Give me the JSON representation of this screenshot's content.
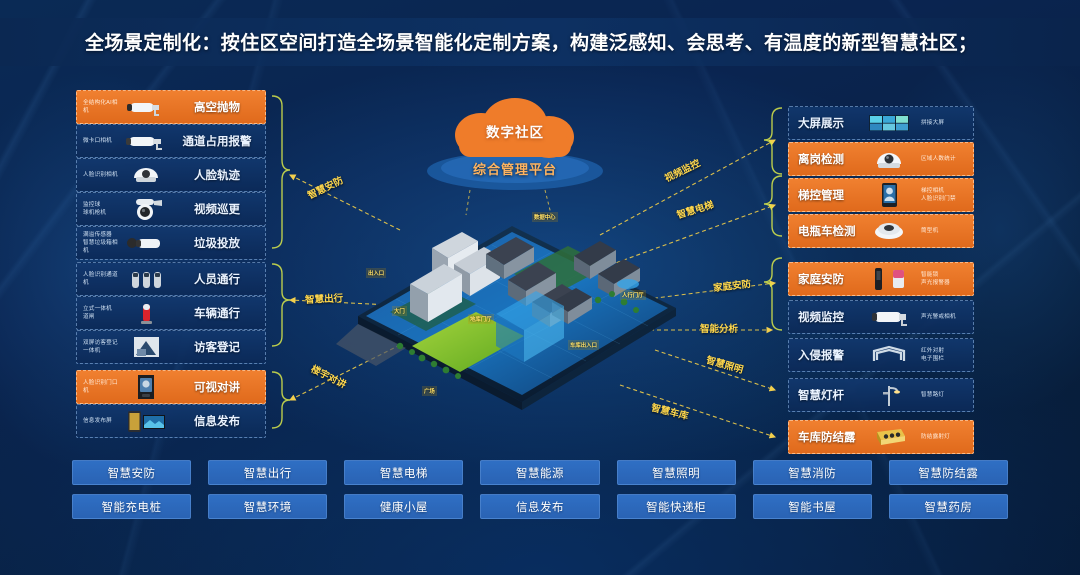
{
  "header": {
    "title": "全场景定制化：按住区空间打造全场景智能化定制方案，构建泛感知、会思考、有温度的新型智慧社区；"
  },
  "center": {
    "cloud_label": "数字社区",
    "platform_label": "综合管理平台",
    "city_labels": [
      "数据中心",
      "人行门厅",
      "地库门厅",
      "车库出入口",
      "出入口",
      "大门",
      "广场"
    ]
  },
  "connectors": {
    "left": [
      {
        "label": "智慧安防"
      },
      {
        "label": "智慧出行"
      },
      {
        "label": "楼宇对讲"
      }
    ],
    "right": [
      {
        "label": "视频监控"
      },
      {
        "label": "智慧电梯"
      },
      {
        "label": "家庭安防"
      },
      {
        "label": "智能分析"
      },
      {
        "label": "智慧照明"
      },
      {
        "label": "智慧车库"
      }
    ]
  },
  "left_groups": [
    {
      "name": "security-group",
      "items": [
        {
          "tiny": "全结构化AI相机",
          "title": "高空抛物",
          "icon": "bullet-camera-icon",
          "highlight": true
        },
        {
          "tiny": "微卡口相机",
          "title": "通道占用报警",
          "icon": "bullet-camera-icon",
          "highlight": false
        },
        {
          "tiny": "人脸识别相机",
          "title": "人脸轨迹",
          "icon": "dome-camera-icon",
          "highlight": false
        },
        {
          "tiny": "监控球\n球机枪机",
          "title": "视频巡更",
          "icon": "ptz-camera-icon",
          "highlight": false
        },
        {
          "tiny": "满溢传感器\n智慧垃圾箱相机",
          "title": "垃圾投放",
          "icon": "bullet-camera-icon",
          "highlight": false
        }
      ]
    },
    {
      "name": "access-group",
      "items": [
        {
          "tiny": "人脸识别通道机",
          "title": "人员通行",
          "icon": "turnstile-icon",
          "highlight": false
        },
        {
          "tiny": "立式一体机\n道闸",
          "title": "车辆通行",
          "icon": "barrier-gate-icon",
          "highlight": false
        },
        {
          "tiny": "双屏访客登记一体机",
          "title": "访客登记",
          "icon": "visitor-kiosk-icon",
          "highlight": false
        }
      ]
    },
    {
      "name": "intercom-group",
      "items": [
        {
          "tiny": "人脸识别门口机",
          "title": "可视对讲",
          "icon": "door-station-icon",
          "highlight": true
        },
        {
          "tiny": "信息发布屏",
          "title": "信息发布",
          "icon": "display-screen-icon",
          "highlight": false
        }
      ]
    }
  ],
  "right_groups": [
    {
      "name": "monitoring-group",
      "items": [
        {
          "title": "大屏展示",
          "tiny": "拼接大屏",
          "icon": "video-wall-icon",
          "highlight": false
        },
        {
          "title": "离岗检测",
          "tiny": "区域人数统计",
          "icon": "dome-camera-icon",
          "highlight": true
        }
      ]
    },
    {
      "name": "elevator-group",
      "items": [
        {
          "title": "梯控管理",
          "tiny": "梯控相机\n人脸识别门禁",
          "icon": "face-terminal-icon",
          "highlight": true
        },
        {
          "title": "电瓶车检测",
          "tiny": "筒型机",
          "icon": "fisheye-camera-icon",
          "highlight": true
        }
      ]
    },
    {
      "name": "home-group",
      "items": [
        {
          "title": "家庭安防",
          "tiny": "智能锁\n声光报警器",
          "icon": "smart-lock-icon",
          "highlight": true
        },
        {
          "title": "视频监控",
          "tiny": "声光警戒相机",
          "icon": "bullet-camera-icon",
          "highlight": false
        },
        {
          "title": "入侵报警",
          "tiny": "红外对射\n电子围栏",
          "icon": "perimeter-fence-icon",
          "highlight": false
        }
      ]
    },
    {
      "name": "lighting-group",
      "items": [
        {
          "title": "智慧灯杆",
          "tiny": "智慧路灯",
          "icon": "smart-pole-icon",
          "highlight": false
        }
      ]
    },
    {
      "name": "garage-group",
      "items": [
        {
          "title": "车库防结露",
          "tiny": "防结露射灯",
          "icon": "spotlight-icon",
          "highlight": true
        }
      ]
    }
  ],
  "tags": {
    "row1": [
      "智慧安防",
      "智慧出行",
      "智慧电梯",
      "智慧能源",
      "智慧照明",
      "智慧消防",
      "智慧防结露"
    ],
    "row2": [
      "智能充电桩",
      "智慧环境",
      "健康小屋",
      "信息发布",
      "智能快递柜",
      "智能书屋",
      "智慧药房"
    ]
  },
  "colors": {
    "accent_orange": "#ef7c2a",
    "accent_yellow": "#ffd84d",
    "panel_blue": "#143a6e",
    "tag_blue": "#2f6fc4"
  }
}
